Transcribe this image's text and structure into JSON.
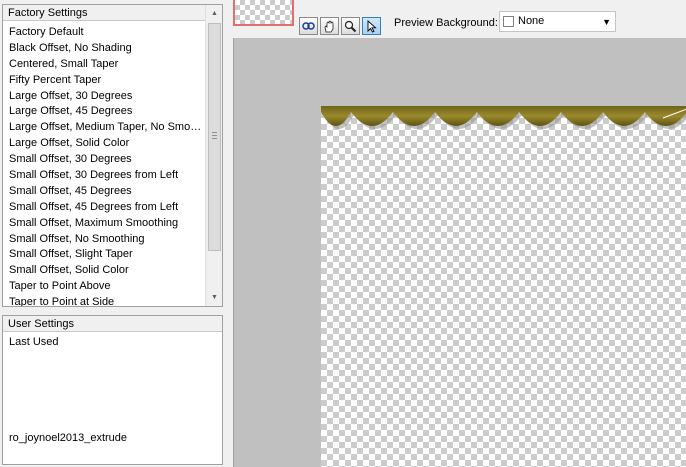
{
  "factory": {
    "header": "Factory Settings",
    "items": [
      "Factory Default",
      "Black Offset, No Shading",
      "Centered, Small Taper",
      "Fifty Percent Taper",
      "Large Offset, 30 Degrees",
      "Large Offset, 45 Degrees",
      "Large Offset, Medium Taper, No Smoothing",
      "Large Offset, Solid Color",
      "Small Offset, 30 Degrees",
      "Small Offset, 30 Degrees from Left",
      "Small Offset, 45 Degrees",
      "Small Offset, 45 Degrees from Left",
      "Small Offset, Maximum Smoothing",
      "Small Offset, No Smoothing",
      "Small Offset, Slight Taper",
      "Small Offset, Solid Color",
      "Taper to Point Above",
      "Taper to Point at Side"
    ]
  },
  "user": {
    "header": "User Settings",
    "items": [
      "Last Used"
    ],
    "file": "ro_joynoel2013_extrude"
  },
  "toolbar": {
    "preview_label": "Preview Background:",
    "preview_value": "None"
  },
  "icons": {
    "zoom_fit": "zoom-fit-icon",
    "pan": "hand-icon",
    "zoom": "magnifier-icon",
    "select": "arrow-pointer-icon"
  },
  "colors": {
    "ribbon": "#8a7a20",
    "ribbon_dark": "#5e5312",
    "preview_bg": "#c0c0c0",
    "thumbnail_border": "#e07070"
  }
}
